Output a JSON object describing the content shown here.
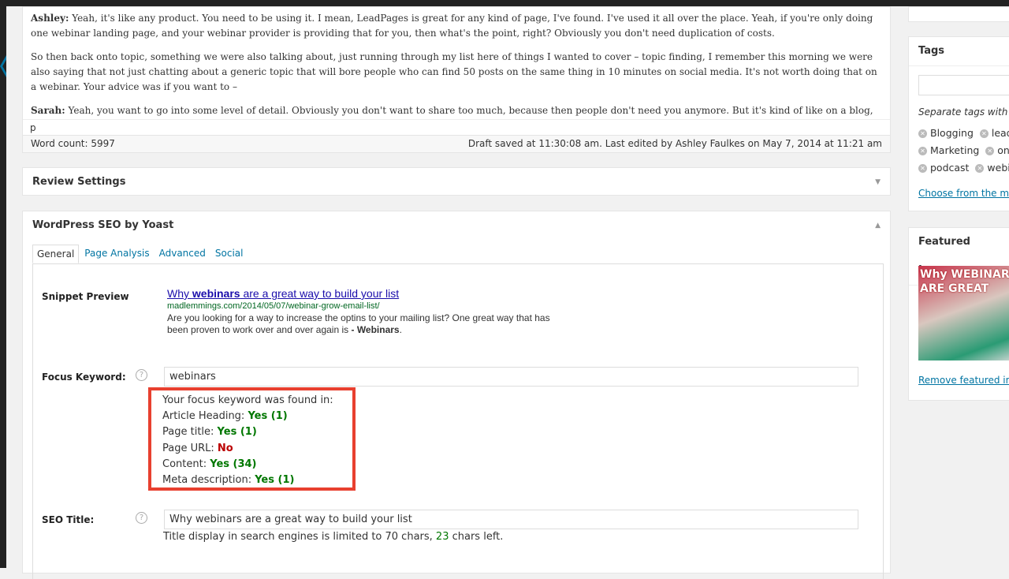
{
  "editor": {
    "p1_speaker": "Ashley:",
    "p1": " Yeah, it's like any product. You need to be using it. I mean, LeadPages is great for any kind of page, I've found. I've used it all over the place. Yeah, if you're only doing one webinar landing page, and your webinar provider is providing that for you, then what's the point, right? Obviously you don't need duplication of costs.",
    "p2": "So then back onto topic, something we were also talking about, just running through my list here of things I wanted to cover – topic finding, I remember this morning we were also saying that not just chatting about a generic topic that will bore people who can find 50 posts on the same thing in 10 minutes on social media. It's not worth doing that on a webinar. Your advice was if you want to –",
    "p3_speaker": "Sarah:",
    "p3": " Yeah, you want to go into some level of detail. Obviously you don't want to share too much, because then people don't need you anymore. But it's kind of like on a blog, exactly. You don't",
    "path": "p",
    "word_count": "Word count: 5997",
    "draft_status": "Draft saved at 11:30:08 am. Last edited by Ashley Faulkes on May 7, 2014 at 11:21 am"
  },
  "review": {
    "title": "Review Settings"
  },
  "yoast": {
    "title": "WordPress SEO by Yoast",
    "tabs": [
      "General",
      "Page Analysis",
      "Advanced",
      "Social"
    ],
    "snippet_label": "Snippet Preview",
    "snippet": {
      "title_pre": "Why ",
      "title_kw": "webinars",
      "title_post": " are a great way to build your list",
      "url": "madlemmings.com/2014/05/07/webinar-grow-email-list/",
      "desc": "Are you looking for a way to increase the optins to your mailing list? One great way that has been proven to work over and over again is ",
      "desc_bold": "- Webinars",
      "desc_end": "."
    },
    "focus_label": "Focus Keyword:",
    "focus_value": "webinars",
    "found": {
      "intro": "Your focus keyword was found in:",
      "rows": [
        {
          "k": "Article Heading: ",
          "v": "Yes (1)"
        },
        {
          "k": "Page title: ",
          "v": "Yes (1)"
        },
        {
          "k": "Page URL: ",
          "v": "No"
        },
        {
          "k": "Content: ",
          "v": "Yes (34)"
        },
        {
          "k": "Meta description: ",
          "v": "Yes (1)"
        }
      ]
    },
    "seo_title_label": "SEO Title:",
    "seo_title_value": "Why webinars are a great way to build your list",
    "title_hint_pre": "Title display in search engines is limited to 70 chars, ",
    "title_hint_num": "23",
    "title_hint_post": " chars left.",
    "help": "?"
  },
  "tags": {
    "title": "Tags",
    "hint": "Separate tags with co",
    "items": [
      "Blogging",
      "lead",
      "Marketing",
      "on",
      "podcast",
      "webi"
    ],
    "choose": "Choose from the mo"
  },
  "featured": {
    "title": "Featured Image",
    "img_line1": "Why WEBINARS",
    "img_line2": "ARE GREAT",
    "remove": "Remove featured im"
  },
  "colors": {
    "accent": "#0074a2",
    "found_border": "#e8402f",
    "yes": "#007700",
    "no": "#bb0000"
  }
}
